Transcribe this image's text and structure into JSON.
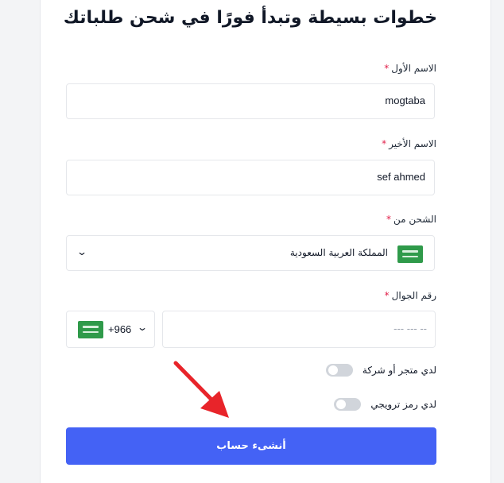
{
  "form": {
    "title": "خطوات بسيطة وتبدأ فورًا في شحن طلباتك",
    "required_mark": "*",
    "first_name": {
      "label": "الاسم الأول",
      "value": "mogtaba"
    },
    "last_name": {
      "label": "الاسم الأخير",
      "value": "sef ahmed"
    },
    "ship_from": {
      "label": "الشحن من",
      "selected": "المملكة العربية السعودية",
      "flag_icon": "saudi-flag-icon"
    },
    "phone": {
      "label": "رقم الجوال",
      "country_code": "+966",
      "placeholder": "--- --- --",
      "flag_icon": "saudi-flag-icon"
    },
    "toggles": [
      {
        "label": "لدي متجر أو شركة",
        "on": false
      },
      {
        "label": "لدي رمز ترويجي",
        "on": false
      }
    ],
    "submit_label": "أنشىء حساب"
  },
  "colors": {
    "primary": "#4462f5",
    "required": "#e11d48",
    "annotation_arrow": "#e8242a",
    "flag": "#2f9a4a"
  },
  "annotation": {
    "icon": "red-arrow-icon",
    "points_to": "submit-button"
  }
}
